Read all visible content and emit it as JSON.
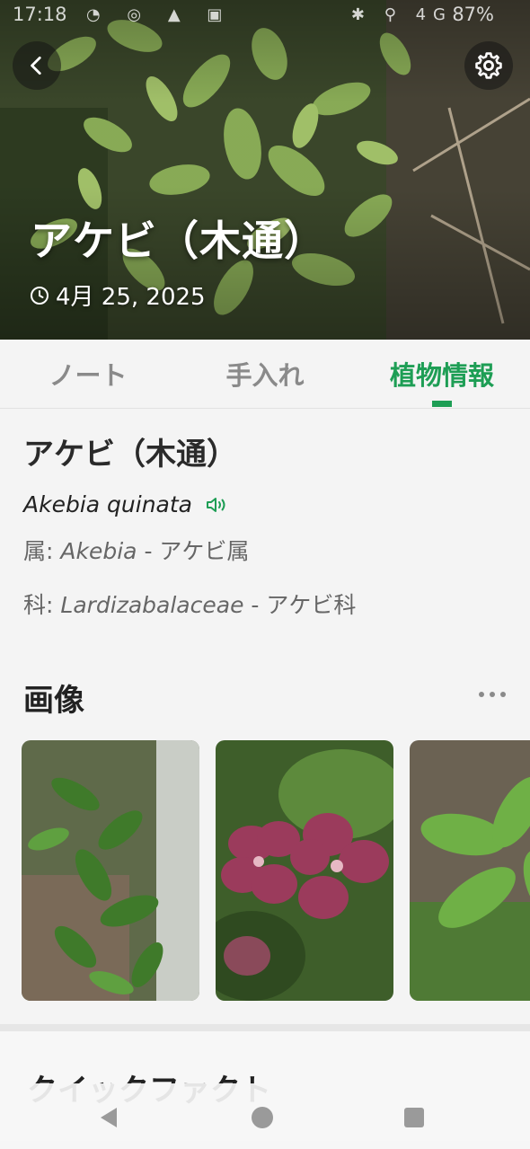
{
  "status": {
    "time": "17:18",
    "left_icons": "◔ ◎ ▲ ▣",
    "right_icons": "✱ ⚲ 4G",
    "battery": "87%"
  },
  "hero": {
    "title": "アケビ（木通）",
    "date": "4月 25, 2025",
    "back_icon": "chevron-left-icon",
    "settings_icon": "gear-icon"
  },
  "tabs": [
    {
      "label": "ノート"
    },
    {
      "label": "手入れ"
    },
    {
      "label": "植物情報",
      "active": true
    }
  ],
  "info": {
    "name": "アケビ（木通）",
    "scientific_name": "Akebia quinata",
    "genus_label": "属:",
    "genus_latin": "Akebia",
    "genus_local": "- アケビ属",
    "family_label": "科:",
    "family_latin": "Lardizabalaceae",
    "family_local": "- アケビ科"
  },
  "images": {
    "title": "画像",
    "items": [
      {
        "icon": "leaf-photo"
      },
      {
        "icon": "flower-photo"
      },
      {
        "icon": "leaf-closeup-photo"
      }
    ]
  },
  "next_section": {
    "title": "クイックファクト"
  },
  "colors": {
    "accent": "#1e9e55",
    "background": "#f4f4f4"
  }
}
